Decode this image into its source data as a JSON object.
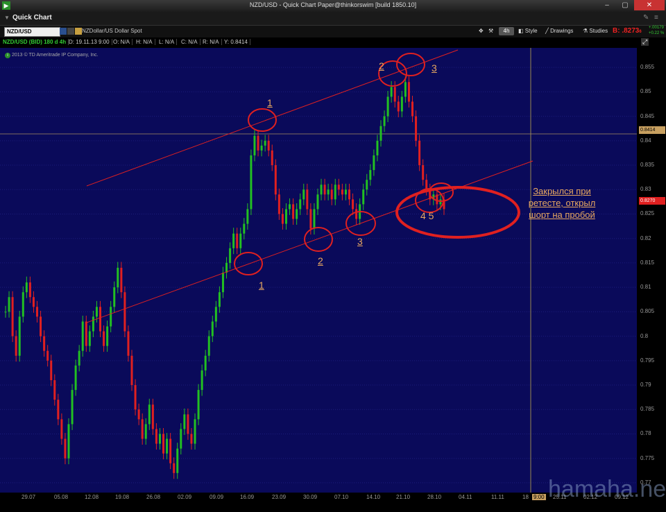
{
  "window": {
    "title": "NZD/USD - Quick Chart Paper@thinkorswim [build 1850.10]"
  },
  "header": {
    "panel_label": "Quick Chart"
  },
  "toolbar": {
    "symbol": "NZD/USD",
    "description": "NZDollar/US Dollar Spot",
    "timeframe": "4h",
    "style_label": "Style",
    "drawings_label": "Drawings",
    "studies_label": "Studies",
    "bid_label": "B: .8273",
    "bid_suffix": "6",
    "change_abs": "+.00179",
    "change_pct": "+0.22 %"
  },
  "infobar": {
    "symbol_info": "NZD/USD (BID) 180 d 4h",
    "date": "D: 19.11.13 9:00",
    "open": "O: N/A",
    "high": "H: N/A",
    "low": "L: N/A",
    "close": "C: N/A",
    "range": "R: N/A",
    "y": "Y: 0.8414"
  },
  "copyright": "2013 © TD Ameritrade IP Company, Inc.",
  "annotation_note": "Закрылся при ретесте, открыл шорт на пробой",
  "annotation_numbers": [
    "1",
    "2",
    "3",
    "1",
    "2",
    "3",
    "4 5"
  ],
  "price_tags": {
    "cursor": "0.8414",
    "current": "0.8270"
  },
  "yaxis_labels": [
    "0.855",
    "0.85",
    "0.845",
    "0.84",
    "0.835",
    "0.83",
    "0.825",
    "0.82",
    "0.815",
    "0.81",
    "0.805",
    "0.8",
    "0.795",
    "0.79",
    "0.785",
    "0.78",
    "0.775",
    "0.77"
  ],
  "xaxis_labels": [
    "29.07",
    "05.08",
    "12.08",
    "19.08",
    "26.08",
    "02.09",
    "09.09",
    "16.09",
    "23.09",
    "30.09",
    "07.10",
    "14.10",
    "21.10",
    "28.10",
    "04.11",
    "11.11",
    "18",
    "9:00",
    "25.11",
    "02.12",
    "09.12"
  ],
  "watermark": "hamaha.net",
  "colors": {
    "up": "#22c022",
    "down": "#e02020",
    "background": "#0a0a5a",
    "channel": "#e02020"
  },
  "chart_data": {
    "type": "candlestick",
    "ylim": [
      0.768,
      0.859
    ],
    "points": [
      [
        0,
        0.805
      ],
      [
        1,
        0.808
      ],
      [
        2,
        0.8
      ],
      [
        3,
        0.796
      ],
      [
        4,
        0.804
      ],
      [
        5,
        0.809
      ],
      [
        6,
        0.811
      ],
      [
        7,
        0.808
      ],
      [
        8,
        0.806
      ],
      [
        9,
        0.804
      ],
      [
        10,
        0.8
      ],
      [
        11,
        0.797
      ],
      [
        12,
        0.795
      ],
      [
        13,
        0.791
      ],
      [
        14,
        0.787
      ],
      [
        15,
        0.783
      ],
      [
        16,
        0.779
      ],
      [
        17,
        0.775
      ],
      [
        18,
        0.782
      ],
      [
        19,
        0.789
      ],
      [
        20,
        0.794
      ],
      [
        21,
        0.797
      ],
      [
        22,
        0.803
      ],
      [
        23,
        0.798
      ],
      [
        24,
        0.801
      ],
      [
        25,
        0.804
      ],
      [
        26,
        0.806
      ],
      [
        27,
        0.801
      ],
      [
        28,
        0.798
      ],
      [
        29,
        0.802
      ],
      [
        30,
        0.806
      ],
      [
        31,
        0.81
      ],
      [
        32,
        0.814
      ],
      [
        33,
        0.809
      ],
      [
        34,
        0.801
      ],
      [
        35,
        0.796
      ],
      [
        36,
        0.79
      ],
      [
        37,
        0.785
      ],
      [
        38,
        0.783
      ],
      [
        39,
        0.779
      ],
      [
        40,
        0.782
      ],
      [
        41,
        0.786
      ],
      [
        42,
        0.781
      ],
      [
        43,
        0.778
      ],
      [
        44,
        0.78
      ],
      [
        45,
        0.776
      ],
      [
        46,
        0.779
      ],
      [
        47,
        0.774
      ],
      [
        48,
        0.772
      ],
      [
        49,
        0.777
      ],
      [
        50,
        0.781
      ],
      [
        51,
        0.784
      ],
      [
        52,
        0.78
      ],
      [
        53,
        0.778
      ],
      [
        54,
        0.783
      ],
      [
        55,
        0.789
      ],
      [
        56,
        0.793
      ],
      [
        57,
        0.796
      ],
      [
        58,
        0.8
      ],
      [
        59,
        0.803
      ],
      [
        60,
        0.806
      ],
      [
        61,
        0.809
      ],
      [
        62,
        0.813
      ],
      [
        63,
        0.815
      ],
      [
        64,
        0.818
      ],
      [
        65,
        0.821
      ],
      [
        66,
        0.818
      ],
      [
        67,
        0.821
      ],
      [
        68,
        0.823
      ],
      [
        69,
        0.826
      ],
      [
        70,
        0.837
      ],
      [
        71,
        0.841
      ],
      [
        72,
        0.838
      ],
      [
        73,
        0.839
      ],
      [
        74,
        0.84
      ],
      [
        75,
        0.838
      ],
      [
        76,
        0.835
      ],
      [
        77,
        0.829
      ],
      [
        78,
        0.825
      ],
      [
        79,
        0.823
      ],
      [
        80,
        0.826
      ],
      [
        81,
        0.827
      ],
      [
        82,
        0.824
      ],
      [
        83,
        0.826
      ],
      [
        84,
        0.828
      ],
      [
        85,
        0.83
      ],
      [
        86,
        0.826
      ],
      [
        87,
        0.822
      ],
      [
        88,
        0.826
      ],
      [
        89,
        0.829
      ],
      [
        90,
        0.831
      ],
      [
        91,
        0.829
      ],
      [
        92,
        0.83
      ],
      [
        93,
        0.828
      ],
      [
        94,
        0.831
      ],
      [
        95,
        0.83
      ],
      [
        96,
        0.829
      ],
      [
        97,
        0.83
      ],
      [
        98,
        0.828
      ],
      [
        99,
        0.826
      ],
      [
        100,
        0.824
      ],
      [
        101,
        0.827
      ],
      [
        102,
        0.83
      ],
      [
        103,
        0.832
      ],
      [
        104,
        0.834
      ],
      [
        105,
        0.837
      ],
      [
        106,
        0.84
      ],
      [
        107,
        0.843
      ],
      [
        108,
        0.845
      ],
      [
        109,
        0.849
      ],
      [
        110,
        0.851
      ],
      [
        111,
        0.848
      ],
      [
        112,
        0.846
      ],
      [
        113,
        0.849
      ],
      [
        114,
        0.852
      ],
      [
        115,
        0.848
      ],
      [
        116,
        0.845
      ],
      [
        117,
        0.84
      ],
      [
        118,
        0.835
      ],
      [
        119,
        0.832
      ],
      [
        120,
        0.83
      ],
      [
        121,
        0.828
      ],
      [
        122,
        0.829
      ],
      [
        123,
        0.827
      ],
      [
        124,
        0.828
      ],
      [
        125,
        0.826
      ]
    ]
  }
}
